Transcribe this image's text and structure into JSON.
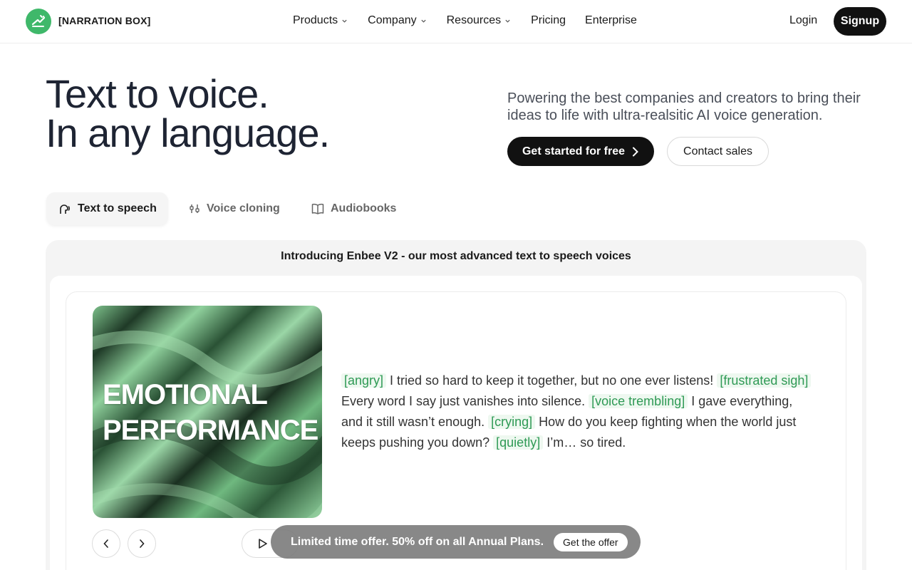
{
  "nav": {
    "brand": "[NARRATION BOX]",
    "links": [
      {
        "label": "Products",
        "dropdown": true
      },
      {
        "label": "Company",
        "dropdown": true
      },
      {
        "label": "Resources",
        "dropdown": true
      },
      {
        "label": "Pricing",
        "dropdown": false
      },
      {
        "label": "Enterprise",
        "dropdown": false
      }
    ],
    "login": "Login",
    "signup": "Signup"
  },
  "hero": {
    "title_line1": "Text to voice.",
    "title_line2": "In any language.",
    "subtitle": "Powering the best companies and creators to bring their ideas to life with ultra-realsitic AI voice generation.",
    "cta_primary": "Get started for free",
    "cta_secondary": "Contact sales"
  },
  "tabs": [
    {
      "label": "Text to speech",
      "icon": "speaking-head-icon",
      "active": true
    },
    {
      "label": "Voice cloning",
      "icon": "sliders-icon",
      "active": false
    },
    {
      "label": "Audiobooks",
      "icon": "book-icon",
      "active": false
    }
  ],
  "panel": {
    "banner": "Introducing Enbee V2 - our most advanced text to speech voices",
    "art_line1": "EMOTIONAL",
    "art_line2": "PERFORMANCE",
    "script": [
      {
        "tag": "[angry]",
        "text": " I tried so hard to keep it together, but no one ever listens! "
      },
      {
        "tag": "[frustrated sigh]",
        "text": " Every word I say just vanishes into silence. "
      },
      {
        "tag": "[voice trembling]",
        "text": " I gave everything, and it still wasn’t enough. "
      },
      {
        "tag": "[crying]",
        "text": " How do you keep fighting when the world just keeps pushing you down? "
      },
      {
        "tag": "[quietly]",
        "text": " I’m… so tired."
      }
    ]
  },
  "offer": {
    "text": "Limited time offer. 50% off on all Annual Plans.",
    "button": "Get the offer"
  },
  "colors": {
    "accent_green": "#3fb86a",
    "tag_green": "#2f9a55",
    "dark": "#111111"
  }
}
